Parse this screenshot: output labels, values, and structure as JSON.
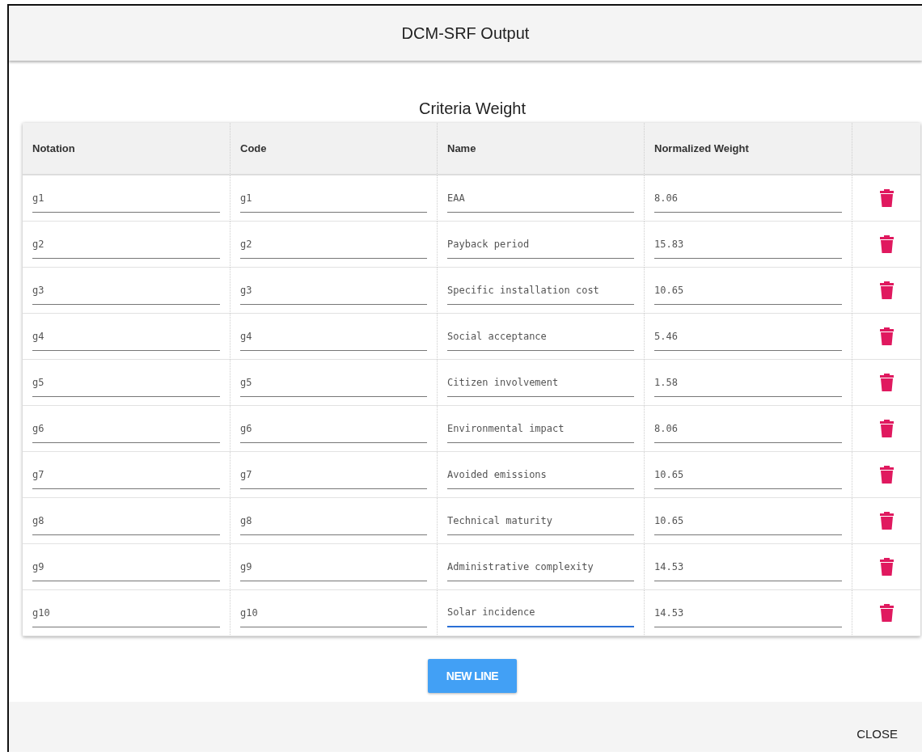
{
  "dialog": {
    "title": "DCM-SRF Output"
  },
  "table": {
    "title": "Criteria Weight",
    "columns": [
      "Notation",
      "Code",
      "Name",
      "Normalized Weight"
    ],
    "rows": [
      {
        "notation": "g1",
        "code": "g1",
        "name": "EAA",
        "weight": "8.06",
        "focused": false
      },
      {
        "notation": "g2",
        "code": "g2",
        "name": "Payback period",
        "weight": "15.83",
        "focused": false
      },
      {
        "notation": "g3",
        "code": "g3",
        "name": "Specific installation cost",
        "weight": "10.65",
        "focused": false
      },
      {
        "notation": "g4",
        "code": "g4",
        "name": "Social acceptance",
        "weight": "5.46",
        "focused": false
      },
      {
        "notation": "g5",
        "code": "g5",
        "name": "Citizen involvement",
        "weight": "1.58",
        "focused": false
      },
      {
        "notation": "g6",
        "code": "g6",
        "name": "Environmental impact",
        "weight": "8.06",
        "focused": false
      },
      {
        "notation": "g7",
        "code": "g7",
        "name": "Avoided emissions",
        "weight": "10.65",
        "focused": false
      },
      {
        "notation": "g8",
        "code": "g8",
        "name": "Technical maturity",
        "weight": "10.65",
        "focused": false
      },
      {
        "notation": "g9",
        "code": "g9",
        "name": "Administrative complexity",
        "weight": "14.53",
        "focused": false
      },
      {
        "notation": "g10",
        "code": "g10",
        "name": "Solar incidence",
        "weight": "14.53",
        "focused": true
      }
    ]
  },
  "buttons": {
    "add": "NEW LINE",
    "close": "CLOSE"
  }
}
